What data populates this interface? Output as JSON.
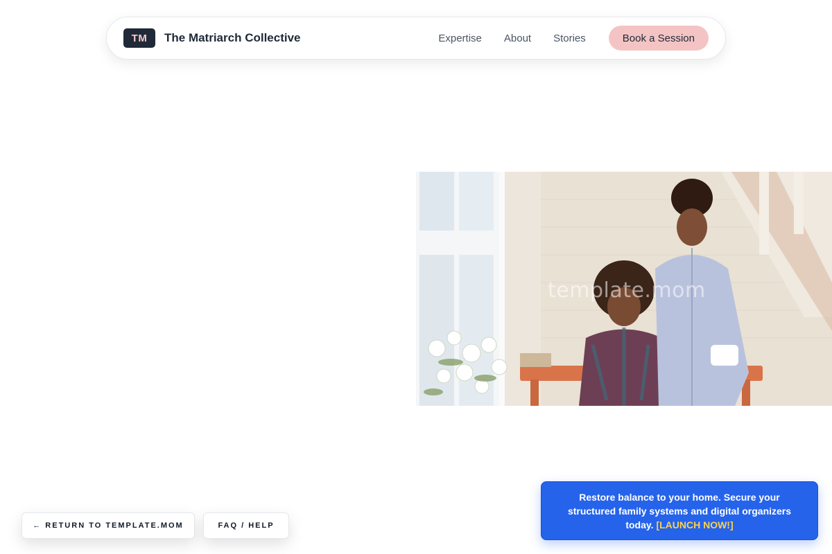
{
  "navbar": {
    "logo_text": "TM",
    "brand_name": "The Matriarch Collective",
    "links": [
      {
        "label": "Expertise"
      },
      {
        "label": "About"
      },
      {
        "label": "Stories"
      }
    ],
    "cta_label": "Book a Session"
  },
  "hero": {
    "watermark": "template.mom"
  },
  "footer": {
    "return_label": "← RETURN TO TEMPLATE.MOM",
    "faq_label": "FAQ / HELP"
  },
  "promo": {
    "text": "Restore balance to your home. Secure your structured family systems and digital organizers today.",
    "link_label": "[LAUNCH NOW!]"
  },
  "colors": {
    "navy": "#1f2937",
    "cta_pink": "#f4c4c4",
    "promo_blue": "#2563eb",
    "promo_link_yellow": "#fcd34d"
  }
}
